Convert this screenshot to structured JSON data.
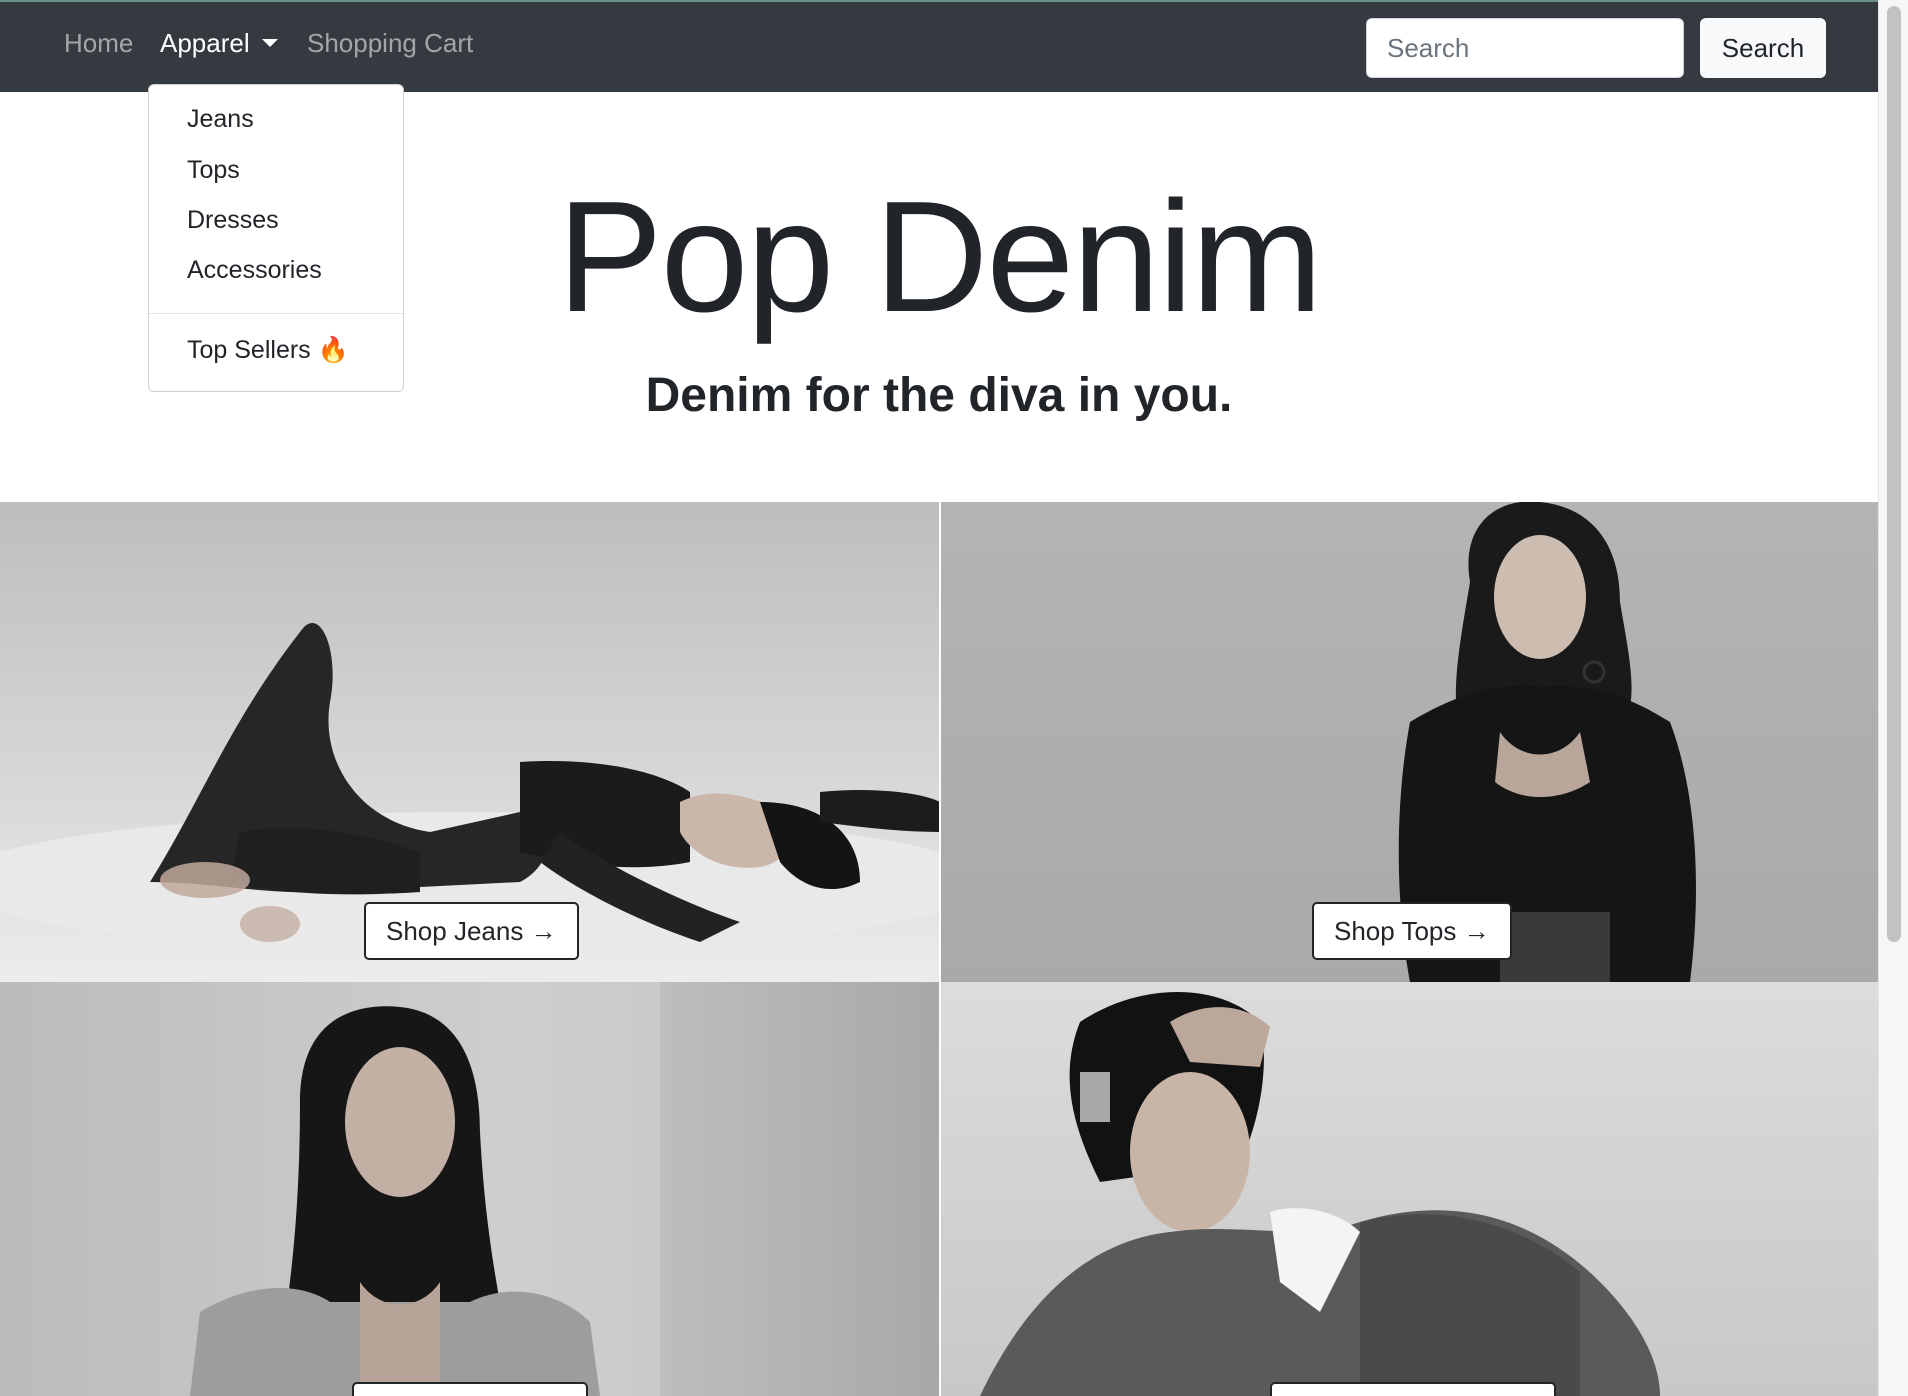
{
  "navbar": {
    "links": [
      {
        "label": "Home"
      },
      {
        "label": "Apparel"
      },
      {
        "label": "Shopping Cart"
      }
    ],
    "search_placeholder": "Search",
    "search_button": "Search"
  },
  "dropdown": {
    "items": [
      {
        "label": "Jeans"
      },
      {
        "label": "Tops"
      },
      {
        "label": "Dresses"
      },
      {
        "label": "Accessories"
      }
    ],
    "featured": {
      "label": "Top Sellers 🔥"
    }
  },
  "hero": {
    "title": "Pop Denim",
    "subtitle": "Denim for the diva in you."
  },
  "tiles": [
    {
      "button": "Shop Jeans →"
    },
    {
      "button": "Shop Tops →"
    },
    {
      "button": ""
    },
    {
      "button": ""
    }
  ]
}
